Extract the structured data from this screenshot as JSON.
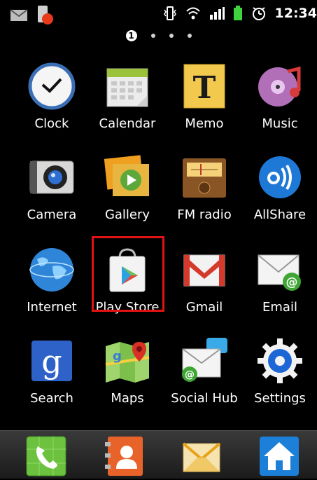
{
  "status_bar": {
    "time": "12:34",
    "left_icons": [
      "mail-icon",
      "notification-app-icon"
    ],
    "right_icons": [
      "vibrate-icon",
      "wifi-icon",
      "signal-icon",
      "battery-icon",
      "alarm-icon"
    ]
  },
  "pager": {
    "current_page": "1",
    "total_pages": 4
  },
  "apps": [
    {
      "label": "Clock",
      "icon": "clock-icon"
    },
    {
      "label": "Calendar",
      "icon": "calendar-icon"
    },
    {
      "label": "Memo",
      "icon": "memo-icon"
    },
    {
      "label": "Music",
      "icon": "music-icon"
    },
    {
      "label": "Camera",
      "icon": "camera-icon"
    },
    {
      "label": "Gallery",
      "icon": "gallery-icon"
    },
    {
      "label": "FM radio",
      "icon": "fm-radio-icon"
    },
    {
      "label": "AllShare",
      "icon": "allshare-icon"
    },
    {
      "label": "Internet",
      "icon": "internet-globe-icon"
    },
    {
      "label": "Play Store",
      "icon": "play-store-icon"
    },
    {
      "label": "Gmail",
      "icon": "gmail-icon"
    },
    {
      "label": "Email",
      "icon": "email-icon"
    },
    {
      "label": "Search",
      "icon": "search-g-icon"
    },
    {
      "label": "Maps",
      "icon": "maps-icon"
    },
    {
      "label": "Social Hub",
      "icon": "social-hub-icon"
    },
    {
      "label": "Settings",
      "icon": "settings-gear-icon"
    }
  ],
  "highlighted_app": "Play Store",
  "dock": [
    {
      "icon": "phone-icon"
    },
    {
      "icon": "contacts-icon"
    },
    {
      "icon": "messaging-icon"
    },
    {
      "icon": "home-icon"
    }
  ],
  "colors": {
    "highlight": "#e01212",
    "background": "#000000"
  }
}
